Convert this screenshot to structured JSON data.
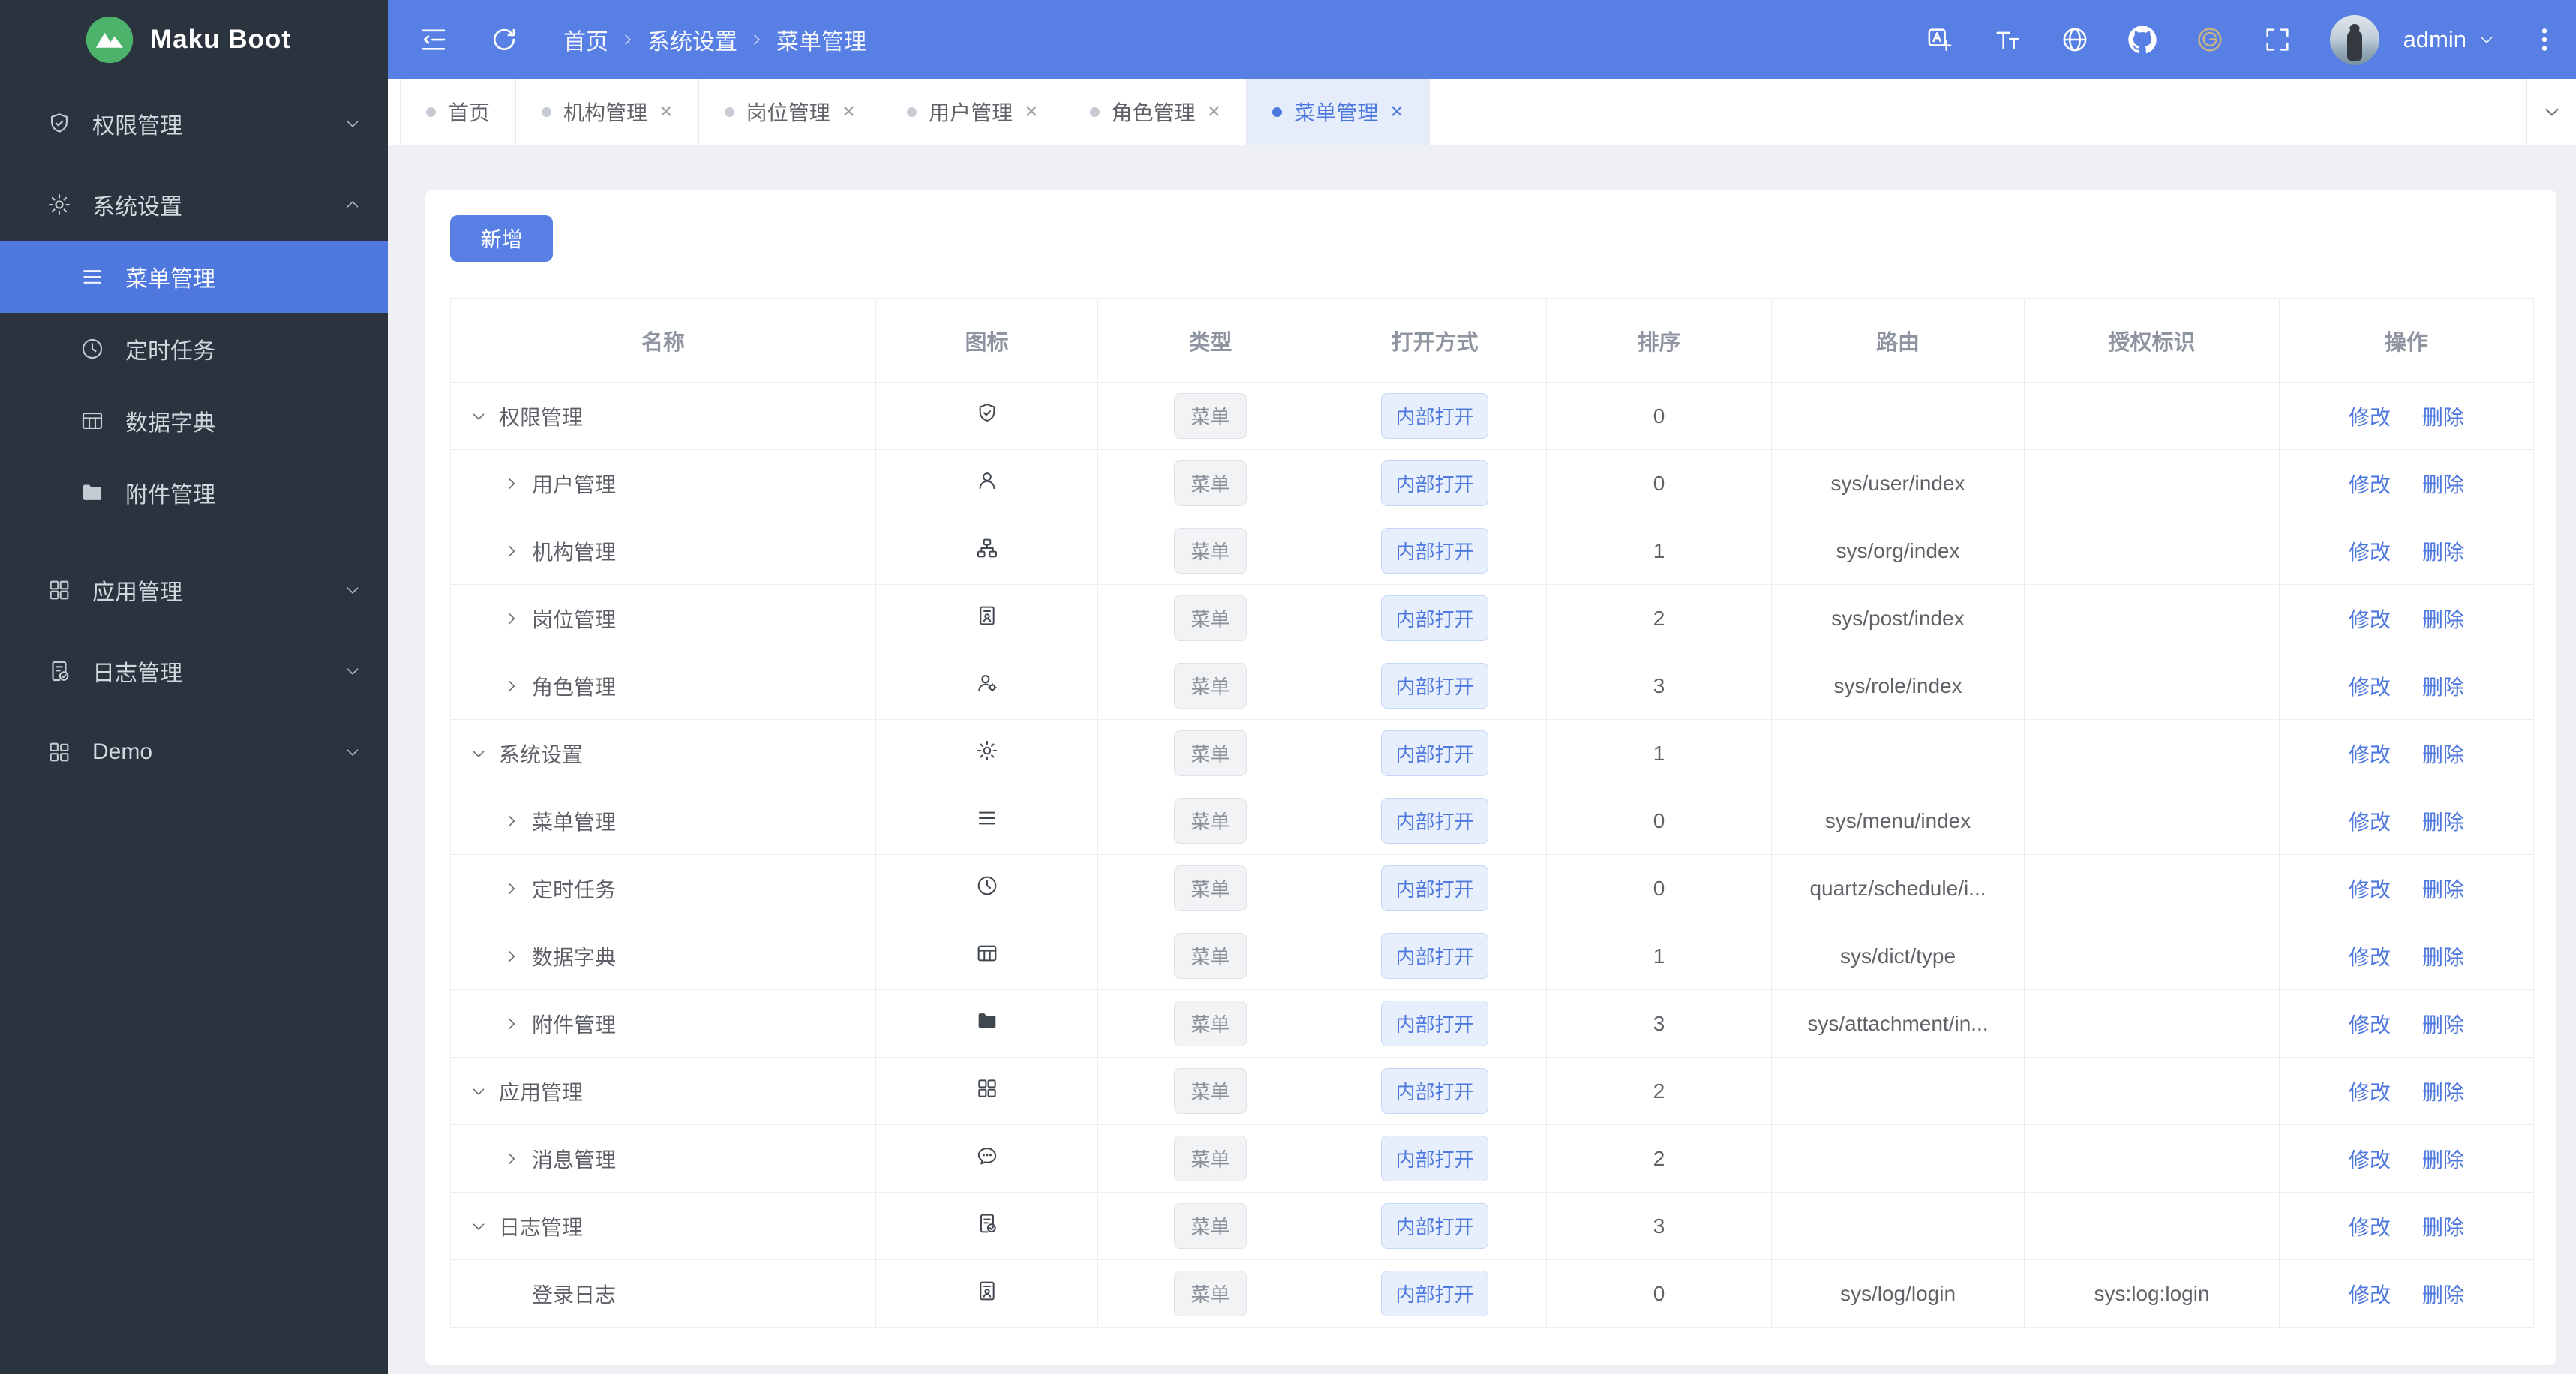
{
  "app": {
    "name": "Maku Boot"
  },
  "colors": {
    "primary": "#4e78dd",
    "header_bg": "#5880e4",
    "sidebar_bg": "#2a333e",
    "sidebar_active_bg": "#4e78dd",
    "page_bg": "#eef0f4",
    "active_tab_bg": "#e5edfb",
    "gitee_icon_color": "#c9b382"
  },
  "header": {
    "breadcrumb": [
      "首页",
      "系统设置",
      "菜单管理"
    ],
    "actions": [
      {
        "icon": "translate-icon"
      },
      {
        "icon": "font-size-icon"
      },
      {
        "icon": "globe-icon"
      },
      {
        "icon": "github-icon"
      },
      {
        "icon": "gitee-icon"
      },
      {
        "icon": "fullscreen-icon"
      }
    ],
    "user": {
      "name": "admin"
    }
  },
  "sidebar": {
    "groups": [
      {
        "label": "权限管理",
        "icon": "shield-check-icon",
        "chevron": "down",
        "children": []
      },
      {
        "label": "系统设置",
        "icon": "gear-icon",
        "chevron": "up",
        "children": [
          {
            "label": "菜单管理",
            "icon": "menu-lines-icon",
            "active": true
          },
          {
            "label": "定时任务",
            "icon": "clock-icon",
            "active": false
          },
          {
            "label": "数据字典",
            "icon": "table-grid-icon",
            "active": false
          },
          {
            "label": "附件管理",
            "icon": "folder-icon",
            "active": false
          }
        ]
      },
      {
        "label": "应用管理",
        "icon": "grid-icon",
        "chevron": "down",
        "children": []
      },
      {
        "label": "日志管理",
        "icon": "doc-check-icon",
        "chevron": "down",
        "children": []
      },
      {
        "label": "Demo",
        "icon": "app-grid-icon",
        "chevron": "down",
        "children": []
      }
    ]
  },
  "tabs": {
    "items": [
      {
        "label": "首页",
        "closable": false,
        "active": false
      },
      {
        "label": "机构管理",
        "closable": true,
        "active": false
      },
      {
        "label": "岗位管理",
        "closable": true,
        "active": false
      },
      {
        "label": "用户管理",
        "closable": true,
        "active": false
      },
      {
        "label": "角色管理",
        "closable": true,
        "active": false
      },
      {
        "label": "菜单管理",
        "closable": true,
        "active": true
      }
    ]
  },
  "toolbar": {
    "add_label": "新增"
  },
  "table": {
    "columns": [
      "名称",
      "图标",
      "类型",
      "打开方式",
      "排序",
      "路由",
      "授权标识",
      "操作"
    ],
    "action_labels": [
      "修改",
      "删除"
    ],
    "rows": [
      {
        "name": "权限管理",
        "level": 0,
        "expand": "down",
        "icon": "shield-check-icon",
        "type": "菜单",
        "open": "内部打开",
        "sort": "0",
        "route": "",
        "auth": ""
      },
      {
        "name": "用户管理",
        "level": 1,
        "expand": "right",
        "icon": "user-icon",
        "type": "菜单",
        "open": "内部打开",
        "sort": "0",
        "route": "sys/user/index",
        "auth": ""
      },
      {
        "name": "机构管理",
        "level": 1,
        "expand": "right",
        "icon": "org-icon",
        "type": "菜单",
        "open": "内部打开",
        "sort": "1",
        "route": "sys/org/index",
        "auth": ""
      },
      {
        "name": "岗位管理",
        "level": 1,
        "expand": "right",
        "icon": "post-card-icon",
        "type": "菜单",
        "open": "内部打开",
        "sort": "2",
        "route": "sys/post/index",
        "auth": ""
      },
      {
        "name": "角色管理",
        "level": 1,
        "expand": "right",
        "icon": "role-user-icon",
        "type": "菜单",
        "open": "内部打开",
        "sort": "3",
        "route": "sys/role/index",
        "auth": ""
      },
      {
        "name": "系统设置",
        "level": 0,
        "expand": "down",
        "icon": "gear-icon",
        "type": "菜单",
        "open": "内部打开",
        "sort": "1",
        "route": "",
        "auth": ""
      },
      {
        "name": "菜单管理",
        "level": 1,
        "expand": "right",
        "icon": "menu-lines-icon",
        "type": "菜单",
        "open": "内部打开",
        "sort": "0",
        "route": "sys/menu/index",
        "auth": ""
      },
      {
        "name": "定时任务",
        "level": 1,
        "expand": "right",
        "icon": "clock-icon",
        "type": "菜单",
        "open": "内部打开",
        "sort": "0",
        "route": "quartz/schedule/i...",
        "auth": ""
      },
      {
        "name": "数据字典",
        "level": 1,
        "expand": "right",
        "icon": "table-grid-icon",
        "type": "菜单",
        "open": "内部打开",
        "sort": "1",
        "route": "sys/dict/type",
        "auth": ""
      },
      {
        "name": "附件管理",
        "level": 1,
        "expand": "right",
        "icon": "folder-icon",
        "type": "菜单",
        "open": "内部打开",
        "sort": "3",
        "route": "sys/attachment/in...",
        "auth": ""
      },
      {
        "name": "应用管理",
        "level": 0,
        "expand": "down",
        "icon": "grid-icon",
        "type": "菜单",
        "open": "内部打开",
        "sort": "2",
        "route": "",
        "auth": ""
      },
      {
        "name": "消息管理",
        "level": 1,
        "expand": "right",
        "icon": "message-icon",
        "type": "菜单",
        "open": "内部打开",
        "sort": "2",
        "route": "",
        "auth": ""
      },
      {
        "name": "日志管理",
        "level": 0,
        "expand": "down",
        "icon": "doc-check-icon",
        "type": "菜单",
        "open": "内部打开",
        "sort": "3",
        "route": "",
        "auth": ""
      },
      {
        "name": "登录日志",
        "level": 1,
        "expand": null,
        "icon": "post-card-icon",
        "type": "菜单",
        "open": "内部打开",
        "sort": "0",
        "route": "sys/log/login",
        "auth": "sys:log:login"
      }
    ]
  }
}
